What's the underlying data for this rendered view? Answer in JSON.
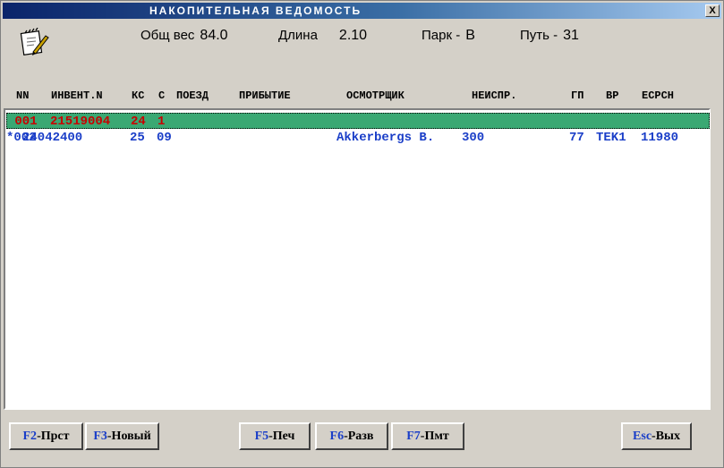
{
  "window": {
    "title": "НАКОПИТЕЛЬНАЯ ВЕДОМОСТЬ",
    "close_label": "X"
  },
  "info": {
    "weight_label": "Общ вес",
    "weight_value": "84.0",
    "length_label": "Длина",
    "length_value": "2.10",
    "park_label": "Парк -",
    "park_value": "В",
    "track_label": "Путь -",
    "track_value": "31"
  },
  "columns": [
    "NN",
    "ИНВЕНТ.N",
    "КС",
    "С",
    "ПОЕЗД",
    "ПРИБЫТИЕ",
    "ОСМОТРЩИК",
    "НЕИСПР.",
    "ГП",
    "ВР",
    "ЕСРСН"
  ],
  "rows": [
    {
      "nn": " 001",
      "invent": "21519004",
      "ks": "24",
      "s": "1",
      "train": "",
      "arrival": "",
      "inspector": "",
      "fault": "",
      "gp": "",
      "vr": "",
      "esrsn": ""
    },
    {
      "nn": "*002",
      "invent": "24042400",
      "ks": "25",
      "s": "09",
      "train": "",
      "arrival": "",
      "inspector": "Akkerbergs B.",
      "fault": "300",
      "gp": "77",
      "vr": "TEK1",
      "esrsn": "11980"
    }
  ],
  "buttons": {
    "f2": {
      "key": "F2",
      "label": "-Прст"
    },
    "f3": {
      "key": "F3",
      "label": "-Новый"
    },
    "f5": {
      "key": "F5",
      "label": "-Печ"
    },
    "f6": {
      "key": "F6",
      "label": "-Разв"
    },
    "f7": {
      "key": "F7",
      "label": "-Пмт"
    },
    "esc": {
      "key": "Esc",
      "label": "-Вых"
    }
  },
  "colors": {
    "selected_row_bg": "#3aa873",
    "selected_row_text": "#c80000",
    "row_text": "#1a3ec8",
    "title_gradient_start": "#0a246a"
  },
  "icons": {
    "app": "notepad-pencil-icon"
  }
}
